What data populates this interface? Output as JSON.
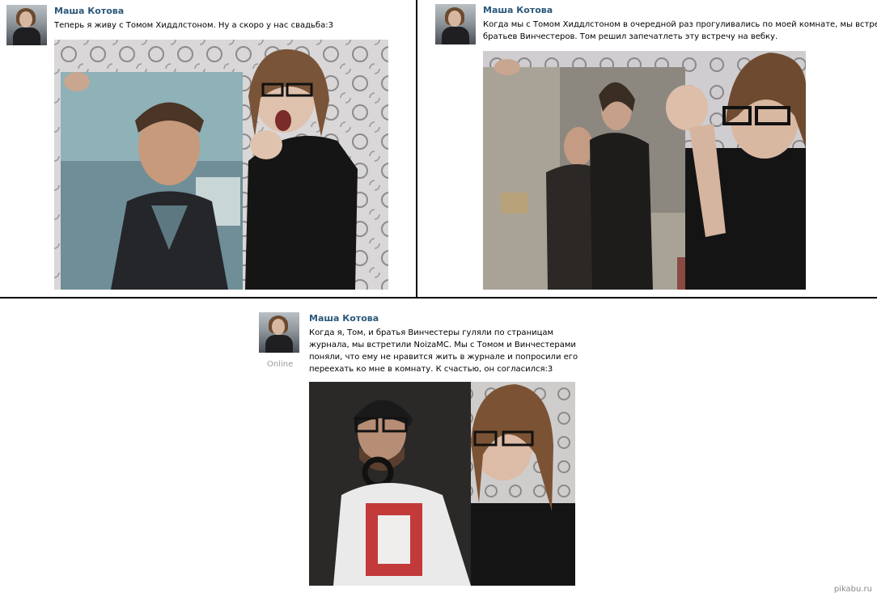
{
  "posts": [
    {
      "author": "Маша Котова",
      "lines": [
        "Теперь я живу с Томом Хиддлстоном. Ну а скоро у нас свадьба:3"
      ]
    },
    {
      "author": "Маша Котова",
      "lines": [
        "Когда мы с Томом Хиддлстоном в очередной раз прогуливались по моей комнате, мы встретили",
        "братьев Винчестеров. Том решил запечатлеть эту встречу на вебку."
      ]
    },
    {
      "author": "Маша Котова",
      "status": "Online",
      "lines": [
        "Когда я, Том, и братья Винчестеры гуляли по страницам",
        "журнала, мы встретили NoizaMC. Мы с Томом и Винчестерами",
        "поняли, что ему не нравится жить в журнале и попросили его",
        "переехать ко мне в комнату. К счастью, он согласился:3"
      ]
    }
  ],
  "watermark": "pikabu.ru",
  "colors": {
    "author": "#2b587a",
    "divider": "#000000",
    "online": "#999999"
  }
}
